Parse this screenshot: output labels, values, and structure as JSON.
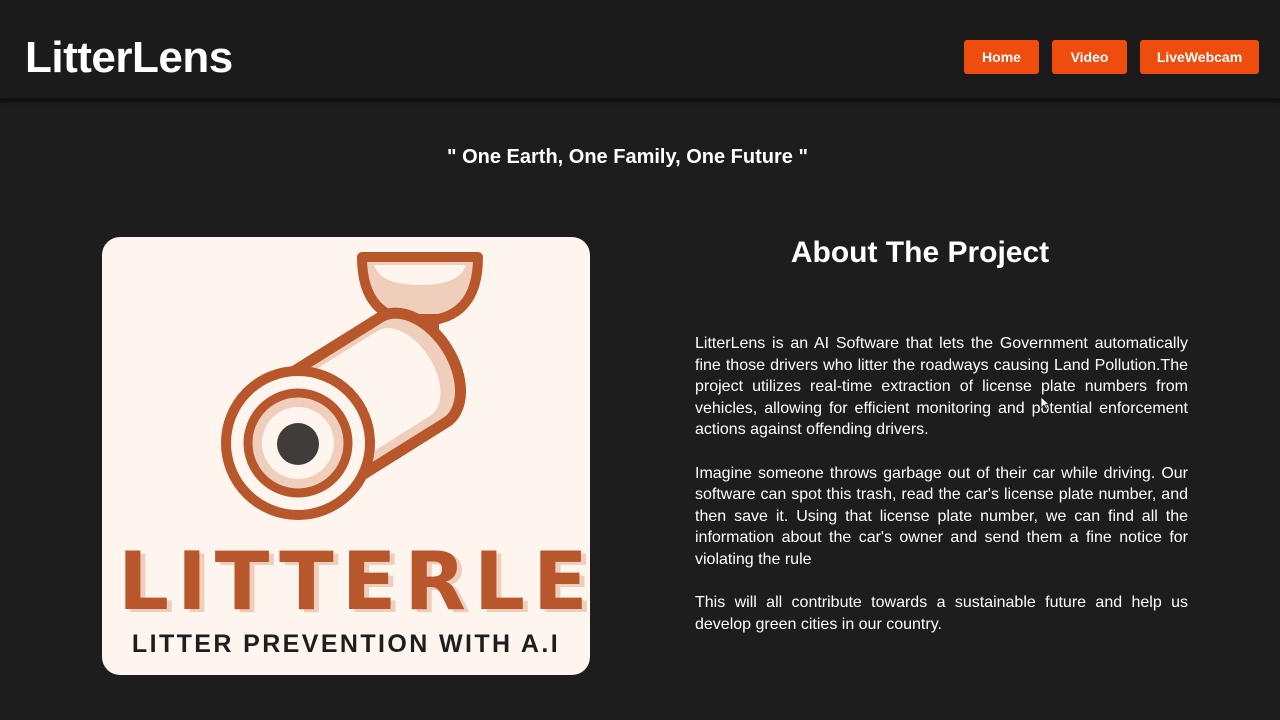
{
  "app": {
    "brand": "LitterLens"
  },
  "nav": {
    "home_label": "Home",
    "video_label": "Video",
    "livewebcam_label": "LiveWebcam"
  },
  "tagline": "\" One Earth, One Family, One Future \"",
  "logo": {
    "title": "LITTERLENS",
    "subtitle": "LITTER PREVENTION WITH A.I",
    "colors": {
      "background": "#fdf5ee",
      "accent": "#b8562c",
      "accent_light": "#efcfbb",
      "lens": "#403c3a"
    }
  },
  "about": {
    "title": "About The Project",
    "paragraphs": [
      "LitterLens is an AI Software that lets the Government automatically fine those drivers who litter the roadways causing Land Pollution.The project utilizes real-time extraction of license plate numbers from vehicles, allowing for efficient monitoring and potential enforcement actions against offending drivers.",
      "Imagine someone throws garbage out of their car while driving. Our software can spot this trash, read the car's license plate number, and then save it. Using that license plate number, we can find all the information about the car's owner and send them a fine notice for violating the rule",
      "This will all contribute towards a sustainable future and help us develop green cities in our country."
    ]
  },
  "theme": {
    "background": "#1d1d1d",
    "button": "#ee4d0e",
    "text": "#ffffff"
  }
}
